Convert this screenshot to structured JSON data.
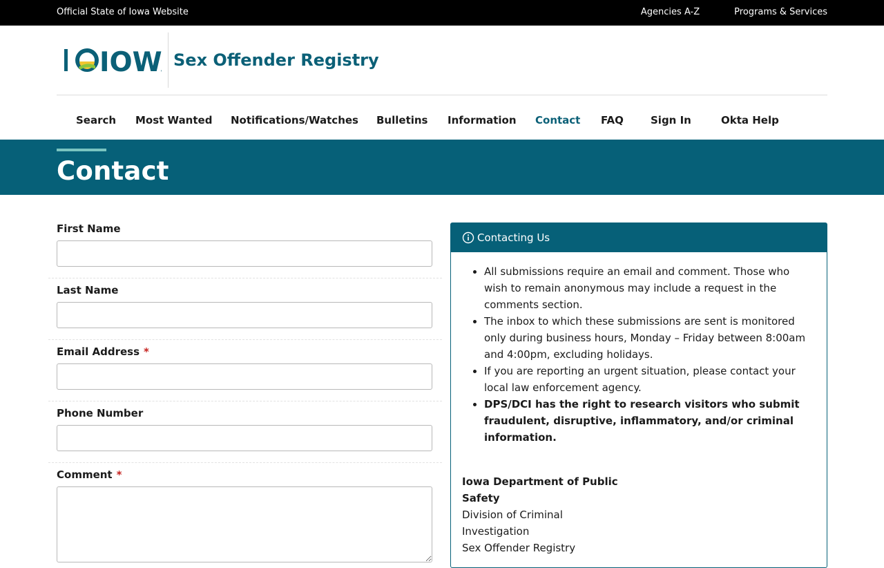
{
  "topbar": {
    "official": "Official State of Iowa Website",
    "links": [
      "Agencies A-Z",
      "Programs & Services"
    ]
  },
  "header": {
    "logo_text": "IOWA",
    "site_title": "Sex Offender Registry"
  },
  "nav": {
    "items": [
      {
        "label": "Search"
      },
      {
        "label": "Most Wanted"
      },
      {
        "label": "Notifications/Watches"
      },
      {
        "label": "Bulletins"
      },
      {
        "label": "Information"
      },
      {
        "label": "Contact",
        "active": true
      },
      {
        "label": "FAQ"
      },
      {
        "label": "Sign In"
      },
      {
        "label": "Okta Help"
      }
    ]
  },
  "page": {
    "title": "Contact"
  },
  "form": {
    "fields": [
      {
        "label": "First Name",
        "required": false,
        "value": ""
      },
      {
        "label": "Last Name",
        "required": false,
        "value": ""
      },
      {
        "label": "Email Address",
        "required": true,
        "value": ""
      },
      {
        "label": "Phone Number",
        "required": false,
        "value": ""
      },
      {
        "label": "Comment",
        "required": true,
        "value": ""
      }
    ],
    "required_marker": "*"
  },
  "panel": {
    "heading": "Contacting Us",
    "items": [
      {
        "text": "All submissions require an email and comment. Those who wish to remain anonymous may include a request in the comments section.",
        "bold": false
      },
      {
        "text": "The inbox to which these submissions are sent is monitored only during business hours, Monday – Friday between 8:00am and 4:00pm, excluding holidays.",
        "bold": false
      },
      {
        "text": "If you are reporting an urgent situation, please contact your local law enforcement agency.",
        "bold": false
      },
      {
        "text": "DPS/DCI has the right to research visitors who submit fraudulent, disruptive, inflammatory, and/or criminal information.",
        "bold": true
      }
    ],
    "address": {
      "org": "Iowa Department of Public Safety",
      "division": "Division of Criminal Investigation",
      "unit": "Sex Offender Registry"
    }
  },
  "colors": {
    "brand_teal": "#066078",
    "accent": "#7ac4c0",
    "required": "#c5221f",
    "logo_yellow": "#f2c530",
    "logo_green": "#8cc63f"
  }
}
